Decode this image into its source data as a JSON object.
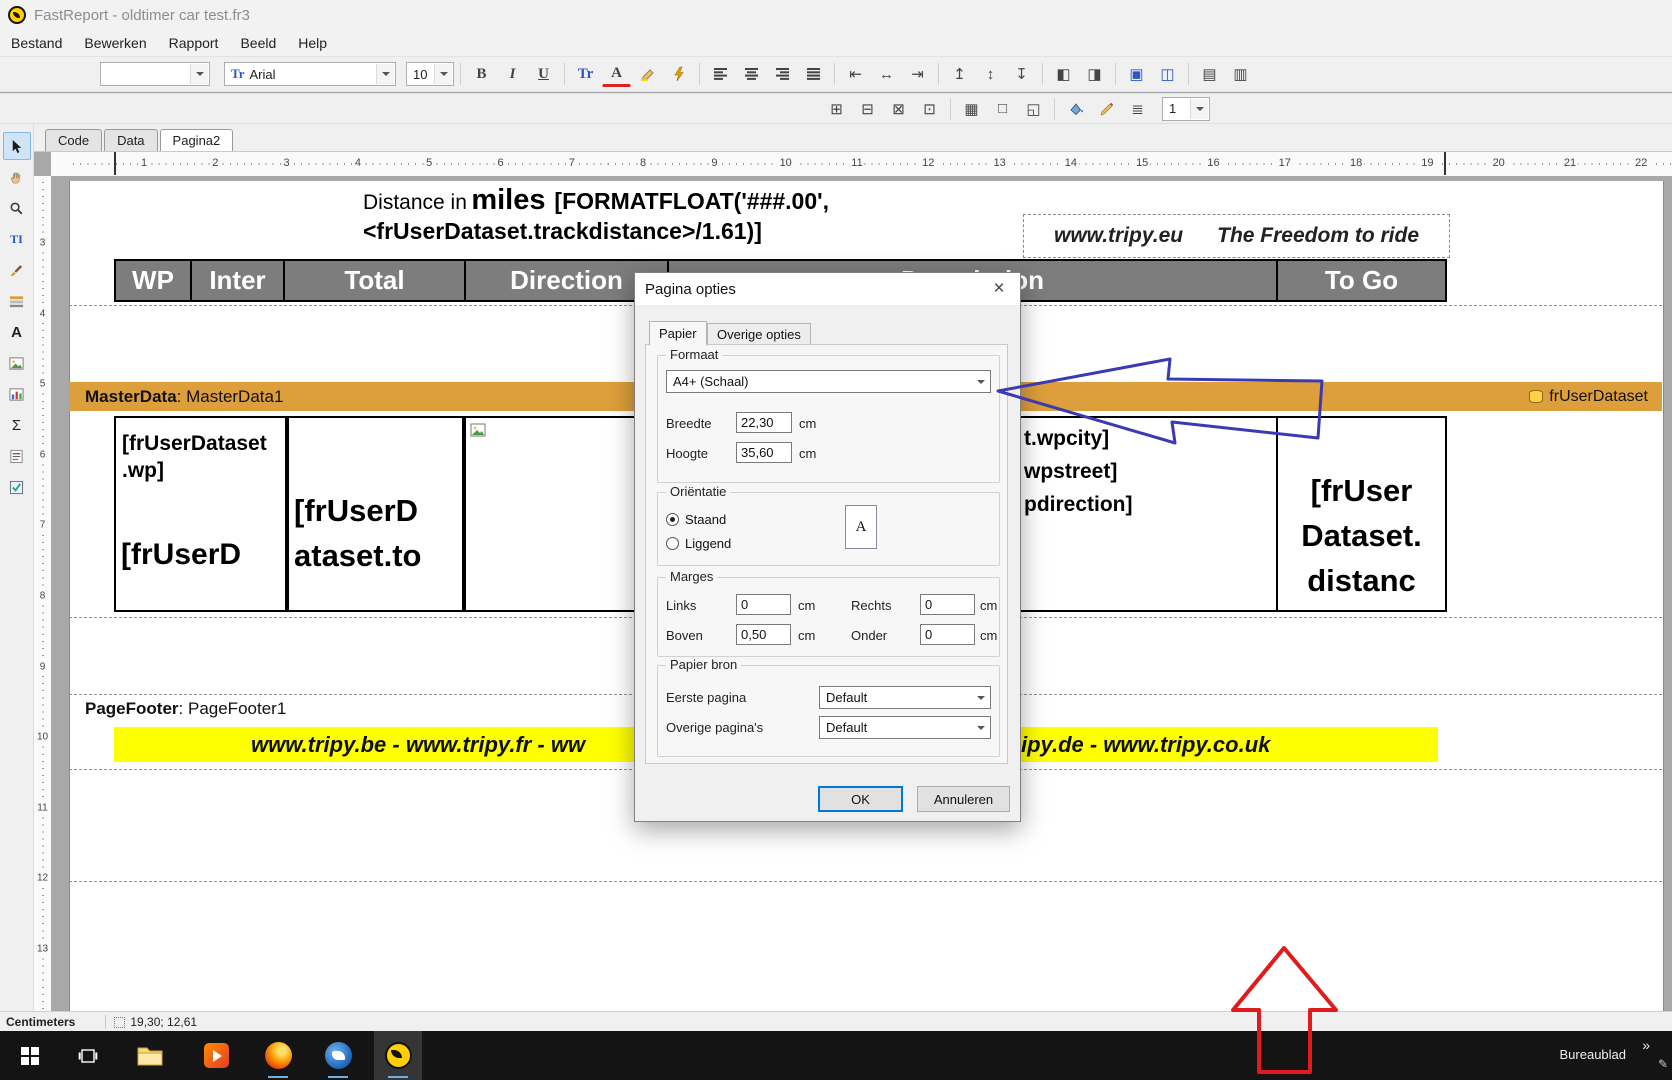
{
  "window": {
    "title": "FastReport - oldtimer car test.fr3"
  },
  "menu": {
    "items": [
      "Bestand",
      "Bewerken",
      "Rapport",
      "Beeld",
      "Help"
    ]
  },
  "toolbar": {
    "style_value": "",
    "font_name": "Arial",
    "font_size": "10",
    "bold": "B",
    "italic": "I",
    "underline": "U",
    "font_icon": "Tr",
    "font_color_icon": "A",
    "zoom_value": "1"
  },
  "tools": {
    "text_edit": "TI",
    "text_object": "A",
    "sum": "Σ"
  },
  "tabs": {
    "items": [
      "Code",
      "Data",
      "Pagina2"
    ]
  },
  "ruler": {
    "h": [
      "1",
      "2",
      "3",
      "4",
      "5",
      "6",
      "7",
      "8",
      "9",
      "10",
      "11",
      "12",
      "13",
      "14",
      "15",
      "16",
      "17",
      "18",
      "19",
      "20",
      "21",
      "22"
    ],
    "v": [
      "3",
      "4",
      "5",
      "6",
      "7",
      "8",
      "9",
      "10",
      "11",
      "12",
      "13"
    ]
  },
  "report": {
    "distance_prefix": "Distance in",
    "distance_miles": "miles",
    "distance_formula1": "[FORMATFLOAT('###.00',",
    "distance_formula2": "<frUserDataset.trackdistance>/1.61)]",
    "tripy_site": "www.tripy.eu",
    "tripy_slogan": "The Freedom to ride",
    "header": [
      "WP",
      "Inter",
      "Total",
      "Direction",
      "Description",
      "To Go"
    ],
    "master_band_bold": "MasterData",
    "master_band_rest": ": MasterData1",
    "dataset_name": "frUserDataset",
    "cell_wp_l1": "[frUserDataset",
    "cell_wp_l2": ".wp]",
    "cell_wp_l3": "[frUserD",
    "cell_total_l1": "[frUserD",
    "cell_total_l2": "ataset.to",
    "frag_city": "t.wpcity]",
    "frag_street": "wpstreet]",
    "frag_direction": "pdirection]",
    "cell_dist_l1": "[frUser",
    "cell_dist_l2": "Dataset.",
    "cell_dist_l3": "distanc",
    "footer_band_bold": "PageFooter",
    "footer_band_rest": ": PageFooter1",
    "yellow_left": "www.tripy.be - www.tripy.fr - ww",
    "yellow_right": "ipy.de - www.tripy.co.uk"
  },
  "dialog": {
    "title": "Pagina opties",
    "tab_papier": "Papier",
    "tab_overige": "Overige opties",
    "formaat_label": "Formaat",
    "formaat_value": "A4+ (Schaal)",
    "breedte_label": "Breedte",
    "breedte_value": "22,30",
    "hoogte_label": "Hoogte",
    "hoogte_value": "35,60",
    "cm": "cm",
    "orientatie_label": "Oriëntatie",
    "staand_label": "Staand",
    "liggend_label": "Liggend",
    "paper_letter": "A",
    "marges_label": "Marges",
    "links_label": "Links",
    "links_value": "0",
    "rechts_label": "Rechts",
    "rechts_value": "0",
    "boven_label": "Boven",
    "boven_value": "0,50",
    "onder_label": "Onder",
    "onder_value": "0",
    "bron_label": "Papier bron",
    "eerste_label": "Eerste pagina",
    "eerste_value": "Default",
    "overige_label": "Overige pagina's",
    "overige_value": "Default",
    "ok_label": "OK",
    "annuleren_label": "Annuleren",
    "close_glyph": "×"
  },
  "statusbar": {
    "units": "Centimeters",
    "coords": "19,30; 12,61"
  },
  "taskbar": {
    "desktop_label": "Bureaublad",
    "chevron": "»",
    "pencil": "✎"
  }
}
